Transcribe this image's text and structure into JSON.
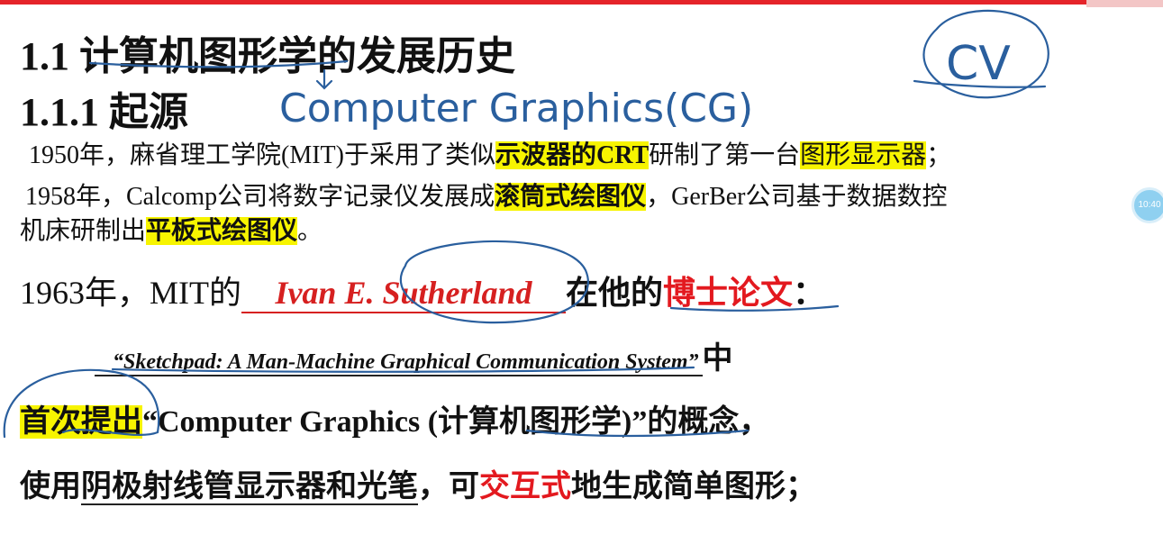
{
  "heading": {
    "h1": "1.1 计算机图形学的发展历史",
    "h2": "1.1.1 起源"
  },
  "p1": {
    "a": "1950年，麻省理工学院(MIT)于采用了类似",
    "hl": "示波器的CRT",
    "b": "研制了第一台",
    "hl2": "图形显示器",
    "c": "；"
  },
  "p2": {
    "a": "1958年，Calcomp公司将数字记录仪发展成",
    "hl": "滚筒式绘图仪",
    "b": "，GerBer公司基于数据数控"
  },
  "p3": {
    "a": "机床研制出",
    "hl": "平板式绘图仪",
    "b": "。"
  },
  "p4": {
    "a": "1963年，MIT的",
    "name": "Ivan E. Sutherland",
    "b": "在他的",
    "red": "博士论文",
    "c": "："
  },
  "p5": {
    "title": "“Sketchpad: A Man-Machine Graphical Communication System”",
    "zhong": "中"
  },
  "p6": {
    "hl": "首次提出",
    "a": "“Computer Graphics (",
    "b": "计算机图形学",
    "c": ")”的概念，"
  },
  "p7": {
    "a": "使用",
    "u": "阴极射线管显示器和光笔",
    "b": "，可",
    "red": "交互式",
    "c": "地生成简单图形；"
  },
  "annotation": {
    "cg": "Computer Graphics(CG)",
    "cv": "CV"
  },
  "badge": "10:40"
}
